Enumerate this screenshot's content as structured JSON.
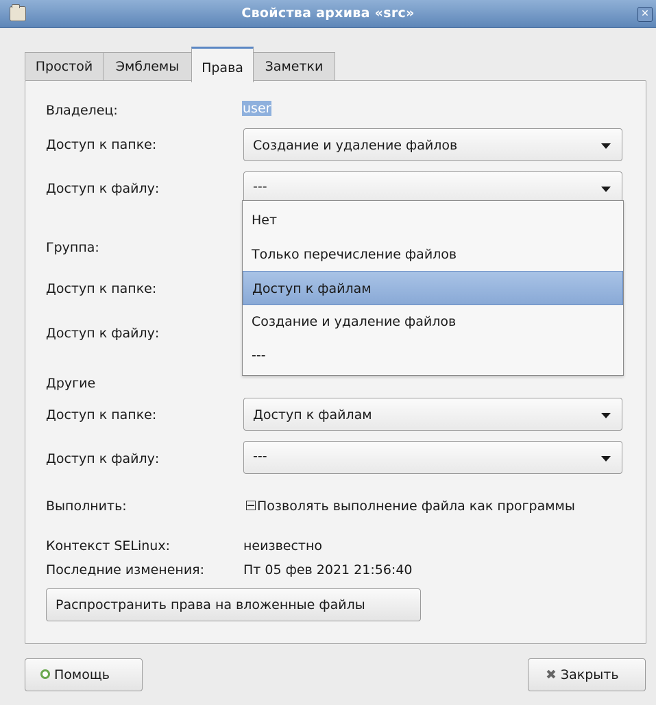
{
  "window": {
    "title": "Свойства архива «src»",
    "close_glyph": "✕"
  },
  "tabs": [
    {
      "label": "Простой"
    },
    {
      "label": "Эмблемы"
    },
    {
      "label": "Права"
    },
    {
      "label": "Заметки"
    }
  ],
  "owner": {
    "label": "Владелец:",
    "value": "user",
    "folder_access_label": "Доступ к папке:",
    "folder_access_value": "Создание и удаление файлов",
    "file_access_label": "Доступ к файлу:",
    "file_access_value": "---"
  },
  "group": {
    "label": "Группа:",
    "folder_access_label": "Доступ к папке:",
    "file_access_label": "Доступ к файлу:"
  },
  "dropdown": {
    "options": [
      "Нет",
      "Только перечисление файлов",
      "Доступ к файлам",
      "Создание и удаление файлов",
      "---"
    ],
    "highlighted": "Доступ к файлам"
  },
  "others": {
    "label": "Другие",
    "folder_access_label": "Доступ к папке:",
    "folder_access_value": "Доступ к файлам",
    "file_access_label": "Доступ к файлу:",
    "file_access_value": "---"
  },
  "execute": {
    "label": "Выполнить:",
    "checkbox_label": "Позволять выполнение файла как программы"
  },
  "selinux": {
    "label": "Контекст SELinux:",
    "value": "неизвестно"
  },
  "modified": {
    "label": "Последние изменения:",
    "value": "Пт 05 фев 2021 21:56:40"
  },
  "buttons": {
    "apply_recursive": "Распространить права на вложенные файлы",
    "help": "Помощь",
    "close": "Закрыть"
  },
  "colors": {
    "titlebar": "#6f94c4",
    "highlight": "#89a9d6",
    "active_tab_accent": "#5b87c4"
  }
}
